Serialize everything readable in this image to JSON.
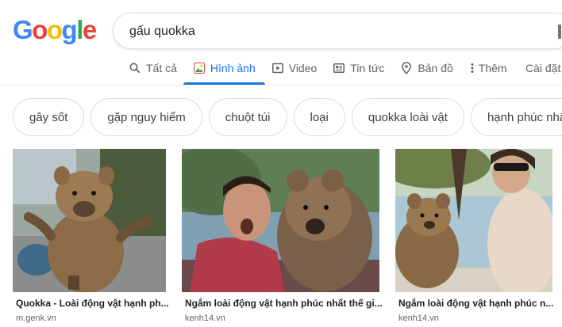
{
  "search": {
    "query": "gấu quokka"
  },
  "tabs": [
    {
      "label": "Tất cả",
      "icon": "search-icon"
    },
    {
      "label": "Hình ảnh",
      "icon": "image-icon",
      "active": true
    },
    {
      "label": "Video",
      "icon": "video-icon"
    },
    {
      "label": "Tin tức",
      "icon": "news-icon"
    },
    {
      "label": "Bản đồ",
      "icon": "map-pin-icon"
    },
    {
      "label": "Thêm",
      "icon": "more-vertical-icon"
    }
  ],
  "tools_label": "Cài đặt",
  "chips": [
    "gây sốt",
    "gặp nguy hiểm",
    "chuột túi",
    "loại",
    "quokka loài vật",
    "hạnh phúc nhất"
  ],
  "results": [
    {
      "title": "Quokka - Loài động vật hạnh ph...",
      "source": "m.genk.vn"
    },
    {
      "title": "Ngắm loài động vật hạnh phúc nhất thế gi...",
      "source": "kenh14.vn"
    },
    {
      "title": "Ngắm loài động vật hạnh phúc n...",
      "source": "kenh14.vn"
    }
  ],
  "colors": {
    "accent": "#1a73e8",
    "google_blue": "#4285f4",
    "google_red": "#ea4335",
    "google_yellow": "#fbbc05",
    "google_green": "#34a853"
  }
}
